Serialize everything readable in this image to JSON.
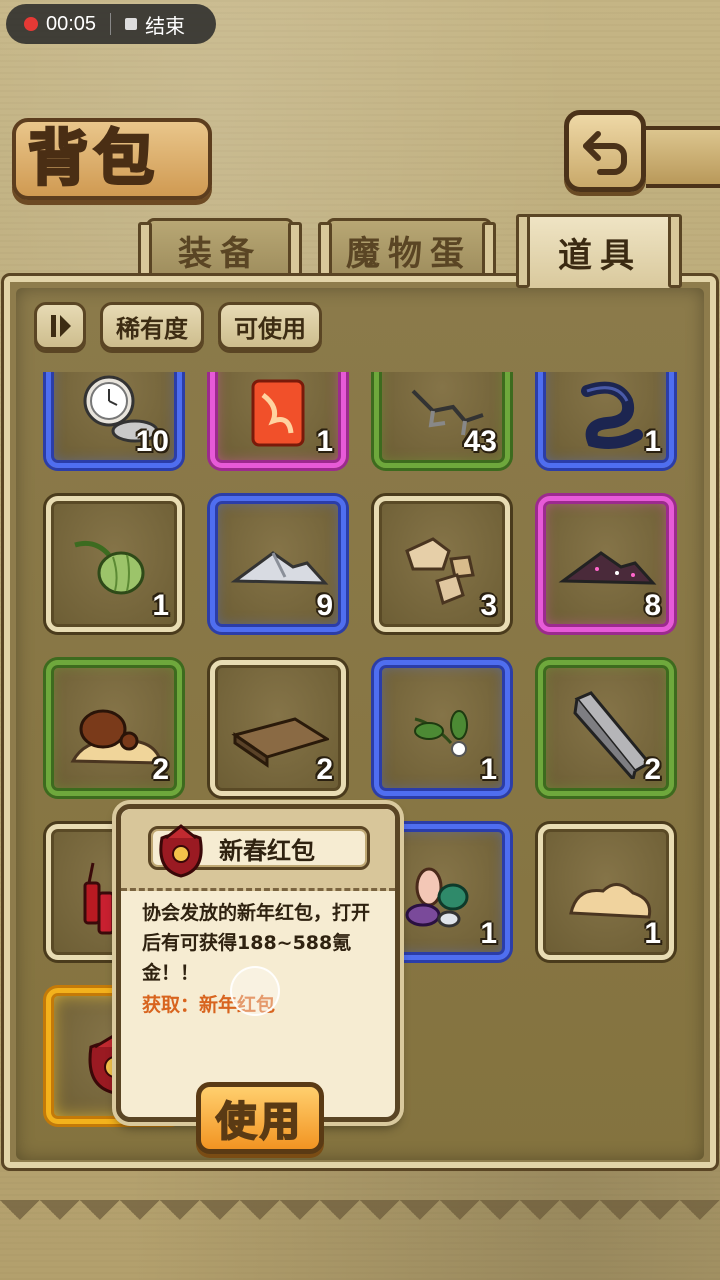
{
  "status_bar": {
    "record_time": "00:05",
    "end_label": "结束"
  },
  "header": {
    "title": "背包",
    "back_icon": "back-arrow-icon"
  },
  "tabs": [
    {
      "label": "装备",
      "active": false
    },
    {
      "label": "魔物蛋",
      "active": false
    },
    {
      "label": "道具",
      "active": true
    }
  ],
  "filters": {
    "sort_icon": "sort-toggle-icon",
    "rarity_label": "稀有度",
    "usable_label": "可使用"
  },
  "items": [
    {
      "icon": "pocket-watch-icon",
      "rarity": "blue",
      "qty": "10"
    },
    {
      "icon": "fire-crystal-icon",
      "rarity": "pink",
      "qty": "1"
    },
    {
      "icon": "chain-hook-icon",
      "rarity": "green",
      "qty": "43"
    },
    {
      "icon": "dark-serpent-icon",
      "rarity": "blue",
      "qty": "1"
    },
    {
      "icon": "green-seed-pod-icon",
      "rarity": "common",
      "qty": "1"
    },
    {
      "icon": "silver-powder-icon",
      "rarity": "blue",
      "qty": "9"
    },
    {
      "icon": "stone-chunks-icon",
      "rarity": "common",
      "qty": "3"
    },
    {
      "icon": "starry-powder-icon",
      "rarity": "pink",
      "qty": "8"
    },
    {
      "icon": "chestnut-mushroom-icon",
      "rarity": "green",
      "qty": "2"
    },
    {
      "icon": "wood-plank-icon",
      "rarity": "common",
      "qty": "2"
    },
    {
      "icon": "flower-sprig-icon",
      "rarity": "blue",
      "qty": "1"
    },
    {
      "icon": "iron-ingot-icon",
      "rarity": "green",
      "qty": "2"
    },
    {
      "icon": "firecracker-icon",
      "rarity": "common",
      "qty": ""
    },
    {
      "icon": "hidden-item-icon",
      "rarity": "common",
      "qty": ""
    },
    {
      "icon": "candy-shells-icon",
      "rarity": "blue",
      "qty": "1"
    },
    {
      "icon": "dough-lump-icon",
      "rarity": "common",
      "qty": "1"
    },
    {
      "icon": "red-envelope-bag-icon",
      "rarity": "gold",
      "qty": ""
    }
  ],
  "popup": {
    "item_name": "新春红包",
    "item_icon": "red-envelope-bag-icon",
    "description": "协会发放的新年红包，打开后有可获得188~588氪金！！",
    "source": "获取：新年红包",
    "use_label": "使用"
  },
  "colors": {
    "rarity_blue": "#4f6ef0",
    "rarity_pink": "#e75ad8",
    "rarity_green": "#6ea83c",
    "rarity_gold": "#f3b21c",
    "source_text": "#d8641e",
    "use_button": "#f29422"
  }
}
